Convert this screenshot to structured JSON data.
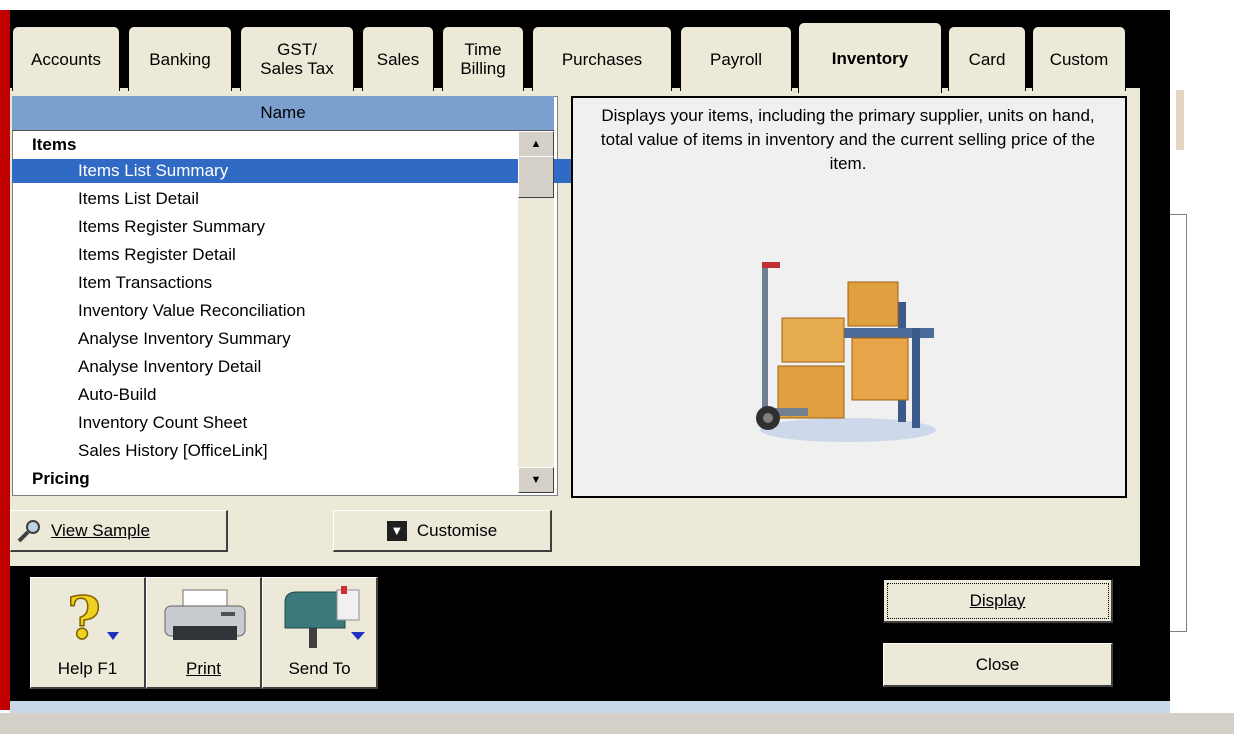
{
  "tabs": [
    {
      "label": "Accounts",
      "active": false
    },
    {
      "label": "Banking",
      "active": false
    },
    {
      "label": "GST/\nSales Tax",
      "active": false
    },
    {
      "label": "Sales",
      "active": false
    },
    {
      "label": "Time\nBilling",
      "active": false
    },
    {
      "label": "Purchases",
      "active": false
    },
    {
      "label": "Payroll",
      "active": false
    },
    {
      "label": "Inventory",
      "active": true
    },
    {
      "label": "Card",
      "active": false
    },
    {
      "label": "Custom",
      "active": false
    }
  ],
  "list": {
    "header": "Name",
    "rows": [
      {
        "label": "Items",
        "kind": "group"
      },
      {
        "label": "Items List Summary",
        "kind": "item",
        "selected": true
      },
      {
        "label": "Items List Detail",
        "kind": "item"
      },
      {
        "label": "Items Register Summary",
        "kind": "item"
      },
      {
        "label": "Items Register Detail",
        "kind": "item"
      },
      {
        "label": "Item Transactions",
        "kind": "item"
      },
      {
        "label": "Inventory Value Reconciliation",
        "kind": "item"
      },
      {
        "label": "Analyse Inventory Summary",
        "kind": "item"
      },
      {
        "label": "Analyse Inventory Detail",
        "kind": "item"
      },
      {
        "label": "Auto-Build",
        "kind": "item"
      },
      {
        "label": "Inventory Count Sheet",
        "kind": "item"
      },
      {
        "label": "Sales History [OfficeLink]",
        "kind": "item"
      },
      {
        "label": "Pricing",
        "kind": "group"
      }
    ]
  },
  "description": "Displays your items, including the primary supplier, units on hand, total value of items in inventory and the current selling price of the item.",
  "buttons": {
    "view_sample": "View Sample",
    "customise": "Customise",
    "display": "Display",
    "close": "Close"
  },
  "toolbar": {
    "help": "Help F1",
    "print": "Print",
    "send_to": "Send To"
  },
  "colors": {
    "selection": "#316ac5",
    "header": "#7ba0cf",
    "frame": "#000000"
  }
}
